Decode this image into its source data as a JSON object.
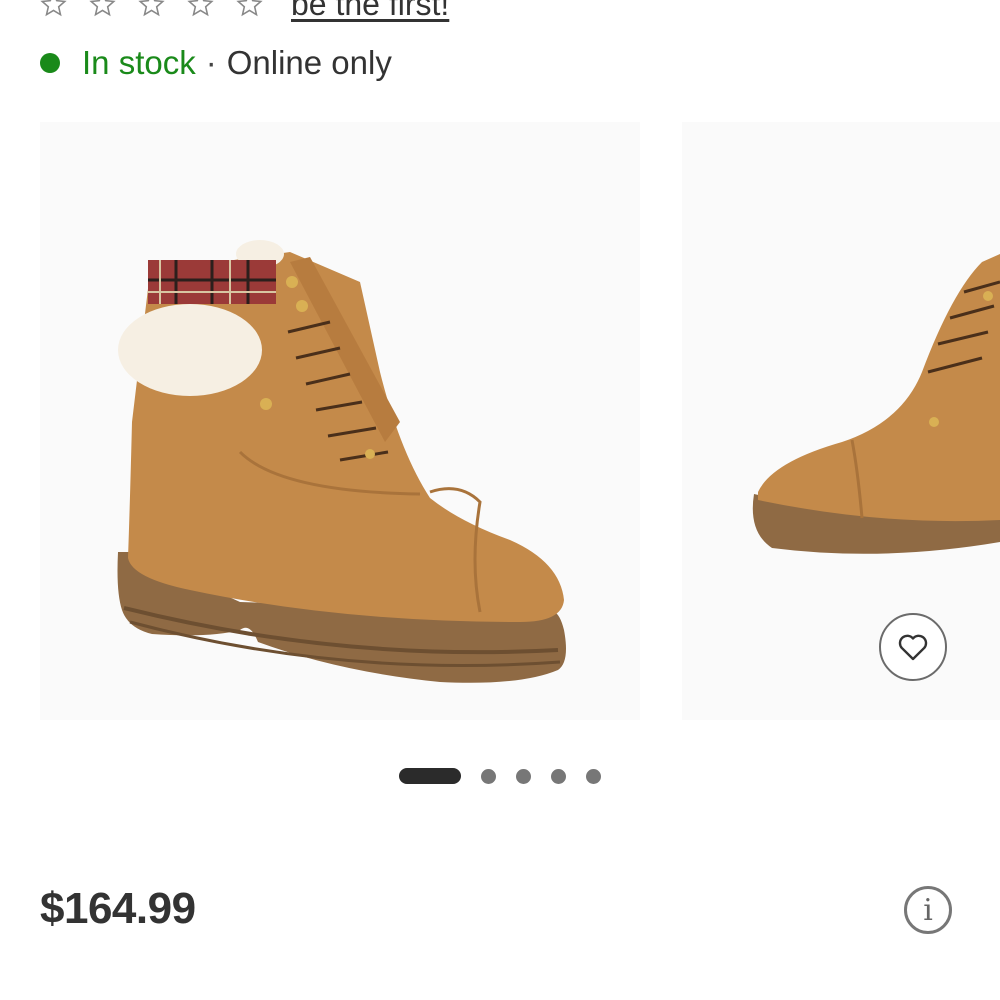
{
  "rating": {
    "stars": [
      "star-empty",
      "star-empty",
      "star-empty",
      "star-empty",
      "star-empty"
    ],
    "review_link": "be the first!"
  },
  "stock": {
    "status": "In stock",
    "separator": "·",
    "availability": "Online only",
    "status_color": "#1a8a1a"
  },
  "gallery": {
    "image_count": 5,
    "active_index": 1,
    "favorite_icon": "heart-icon"
  },
  "price": {
    "value": "$164.99",
    "info_icon": "i",
    "info_icon_name": "info-icon"
  },
  "colors": {
    "suede": "#c48a4a",
    "sole": "#8f6a44",
    "fur": "#f6efe3",
    "plaid": "#9b3a38"
  }
}
